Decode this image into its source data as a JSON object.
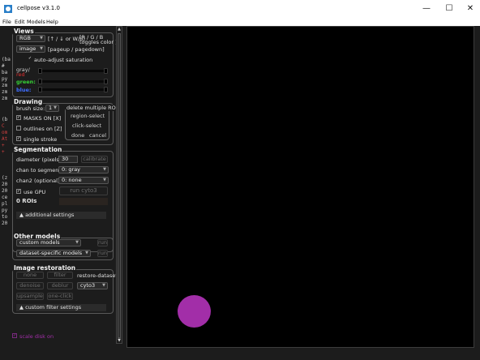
{
  "window": {
    "title": "cellpose v3.1.0",
    "minimize": "—",
    "maximize": "☐",
    "close": "✕"
  },
  "menu": [
    "File",
    "Edit",
    "Models",
    "Help"
  ],
  "terminal": [
    "(ba",
    "",
    "#",
    "",
    "ba",
    "py",
    "zm",
    "zm",
    "zm",
    "",
    "(b",
    "C",
    "om",
    "At",
    "+",
    "+",
    "",
    "(z",
    "20",
    "20",
    "ce",
    "pl",
    "py",
    "to",
    "20"
  ],
  "views": {
    "title": "Views",
    "channel_combo": "RGB",
    "channel_hint": "[↑ / ↓ or W/S]",
    "rgb_hint_1": "[R / G / B",
    "rgb_hint_2": "toggles color ]",
    "image_combo": "image",
    "image_hint": "[pageup / pagedown]",
    "autoadjust_label": "auto-adjust saturation",
    "autoadjust_checked": "✓",
    "gray_label": "gray/",
    "red_label": "red",
    "green_label": "green:",
    "blue_label": "blue:",
    "colors": {
      "red": "#e23030",
      "green": "#36d236",
      "blue": "#3f6dff"
    }
  },
  "drawing": {
    "title": "Drawing",
    "brush_label": "brush size:",
    "brush_value": "1",
    "masks_label": "MASKS ON [X]",
    "masks_checked": "✓",
    "outlines_label": "outlines on [Z]",
    "single_stroke_label": "single stroke",
    "single_stroke_checked": "✓",
    "delete_group": "delete multiple ROIs",
    "region_select": "region-select",
    "click_select": "click-select",
    "done": "done",
    "cancel": "cancel"
  },
  "segmentation": {
    "title": "Segmentation",
    "diameter_label": "diameter (pixels):",
    "diameter_value": "30",
    "calibrate": "calibrate",
    "chan_seg_label": "chan to segment:",
    "chan_seg_value": "0: gray",
    "chan2_label": "chan2 (optional):",
    "chan2_value": "0: none",
    "gpu_label": "use GPU",
    "gpu_checked": "✓",
    "run_button": "run cyto3",
    "roi_count": "0 ROIs",
    "additional": "▲ additional settings"
  },
  "other_models": {
    "title": "Other models",
    "custom_combo": "custom models",
    "run1": "run",
    "dataset_combo": "dataset-specific models",
    "run2": "run"
  },
  "restoration": {
    "title": "Image restoration",
    "none": "none",
    "filter": "filter",
    "restore_label": "restore-dataset",
    "denoise": "denoise",
    "deblur": "deblur",
    "dataset_value": "cyto3",
    "upsample": "upsample",
    "onechannel": "one-click",
    "custom_filter": "▲ custom filter settings"
  },
  "scale_disk": {
    "label": "scale disk on",
    "checked": "✓"
  },
  "cell_color": "#a22ea8"
}
